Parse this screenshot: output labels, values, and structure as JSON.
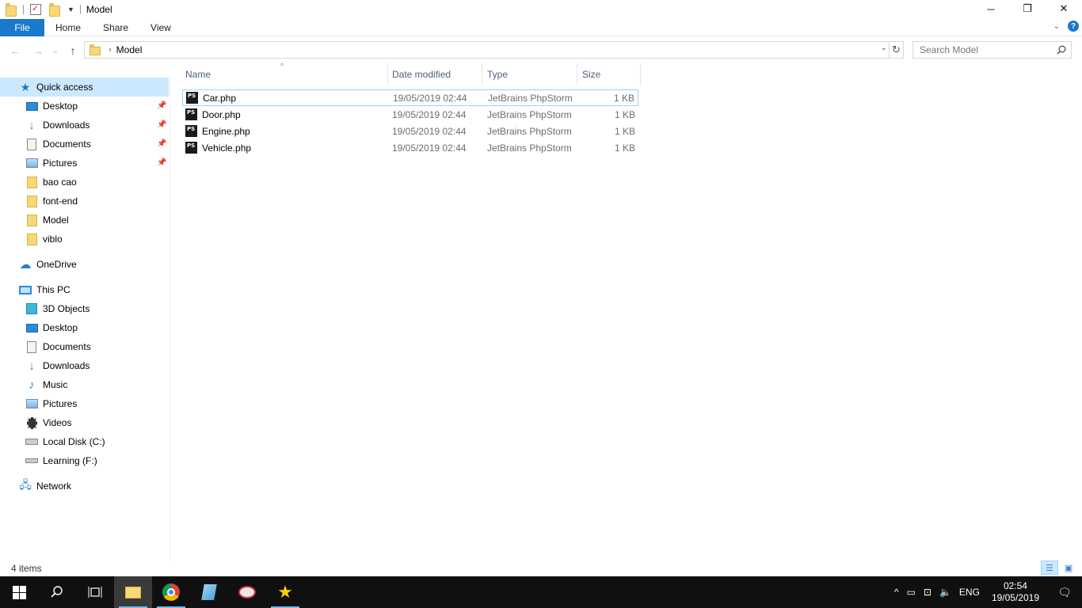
{
  "window": {
    "title": "Model",
    "controls": {
      "minimize": "─",
      "restore": "❐",
      "close": "✕"
    }
  },
  "ribbon": {
    "tabs": [
      "File",
      "Home",
      "Share",
      "View"
    ],
    "help": "?",
    "expand": "⌄"
  },
  "address": {
    "back": "←",
    "forward": "→",
    "recent": "⌄",
    "up": "↑",
    "path": [
      "Model"
    ],
    "separator": "›",
    "dropdown": "⌄",
    "refresh": "↻",
    "search_placeholder": "Search Model"
  },
  "nav": {
    "quick_access": {
      "label": "Quick access",
      "items": [
        {
          "label": "Desktop",
          "icon": "desktop-icon",
          "pinned": true
        },
        {
          "label": "Downloads",
          "icon": "downloads-icon",
          "pinned": true
        },
        {
          "label": "Documents",
          "icon": "documents-icon",
          "pinned": true
        },
        {
          "label": "Pictures",
          "icon": "pictures-icon",
          "pinned": true
        },
        {
          "label": "bao cao",
          "icon": "folder-icon",
          "pinned": false
        },
        {
          "label": "font-end",
          "icon": "folder-icon",
          "pinned": false
        },
        {
          "label": "Model",
          "icon": "folder-icon",
          "pinned": false
        },
        {
          "label": "viblo",
          "icon": "folder-icon",
          "pinned": false
        }
      ]
    },
    "onedrive": "OneDrive",
    "this_pc": {
      "label": "This PC",
      "items": [
        {
          "label": "3D Objects",
          "icon": "3d-objects-icon"
        },
        {
          "label": "Desktop",
          "icon": "desktop-icon"
        },
        {
          "label": "Documents",
          "icon": "documents-icon"
        },
        {
          "label": "Downloads",
          "icon": "downloads-icon"
        },
        {
          "label": "Music",
          "icon": "music-icon"
        },
        {
          "label": "Pictures",
          "icon": "pictures-icon"
        },
        {
          "label": "Videos",
          "icon": "videos-icon"
        },
        {
          "label": "Local Disk (C:)",
          "icon": "local-disk-icon"
        },
        {
          "label": "Learning (F:)",
          "icon": "drive-icon"
        }
      ]
    },
    "network": "Network"
  },
  "columns": {
    "name": "Name",
    "date": "Date modified",
    "type": "Type",
    "size": "Size"
  },
  "files": [
    {
      "name": "Car.php",
      "date": "19/05/2019 02:44",
      "type": "JetBrains PhpStorm",
      "size": "1 KB"
    },
    {
      "name": "Door.php",
      "date": "19/05/2019 02:44",
      "type": "JetBrains PhpStorm",
      "size": "1 KB"
    },
    {
      "name": "Engine.php",
      "date": "19/05/2019 02:44",
      "type": "JetBrains PhpStorm",
      "size": "1 KB"
    },
    {
      "name": "Vehicle.php",
      "date": "19/05/2019 02:44",
      "type": "JetBrains PhpStorm",
      "size": "1 KB"
    }
  ],
  "file_icon_text": "PS",
  "status": {
    "item_count": "4 items"
  },
  "taskbar": {
    "lang": "ENG",
    "time": "02:54",
    "date": "19/05/2019",
    "colors": {
      "background": "#101010",
      "accent": "#1979ca"
    }
  }
}
